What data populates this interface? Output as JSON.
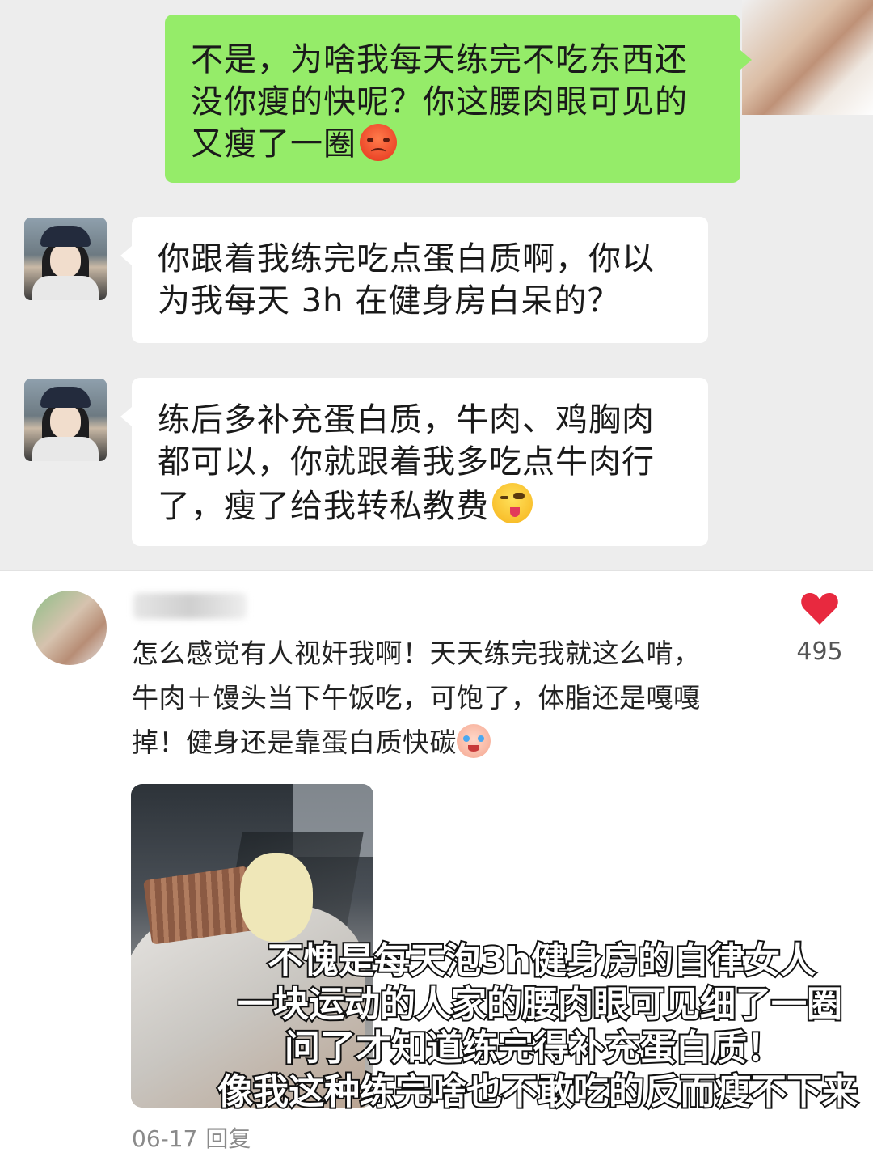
{
  "chat": {
    "messages": [
      {
        "sender": "self",
        "lines": [
          "不是，为啥我每天练完不吃东西还",
          "没你瘦的快呢？你这腰肉眼可见的",
          "又瘦了一圈"
        ],
        "emoji": "angry-face"
      },
      {
        "sender": "other",
        "lines": [
          "你跟着我练完吃点蛋白质啊，你以",
          "为我每天 3h 在健身房白呆的？"
        ]
      },
      {
        "sender": "other",
        "lines": [
          "练后多补充蛋白质，牛肉、鸡胸肉",
          "都可以，你就跟着我多吃点牛肉行",
          "了，瘦了给我转私教费"
        ],
        "emoji": "winking-tongue-face"
      }
    ],
    "colors": {
      "self_bubble": "#95ec69",
      "other_bubble": "#ffffff",
      "background": "#ededed"
    }
  },
  "comment": {
    "lines": [
      "怎么感觉有人视奸我啊！天天练完我就这么啃，",
      "牛肉＋馒头当下午饭吃，可饱了，体脂还是嘎嘎",
      "掉！健身还是靠蛋白质快碳"
    ],
    "emoji": "crying-baby-face",
    "like_icon": "heart-icon",
    "like_color": "#e8293f",
    "like_count": "495",
    "date": "06-17",
    "reply_label": "回复"
  },
  "overlay_caption": {
    "lines": [
      "不愧是每天泡3h健身房的自律女人",
      "一块运动的人家的腰肉眼可见细了一圈",
      "问了才知道练完得补充蛋白质！",
      "像我这种练完啥也不敢吃的反而瘦不下来"
    ]
  }
}
